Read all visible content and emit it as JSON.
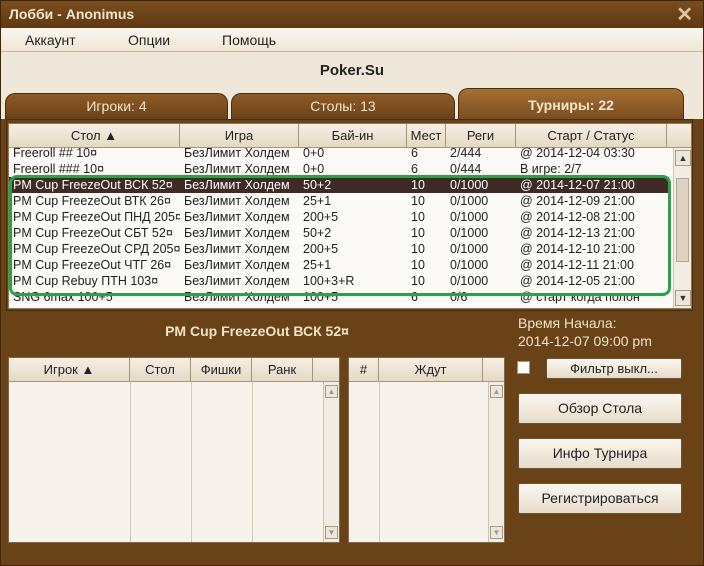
{
  "window": {
    "title": "Лобби - Anonimus"
  },
  "menu": {
    "items": [
      "Аккаунт",
      "Опции",
      "Помощь"
    ]
  },
  "brand": "Poker.Su",
  "tabs": [
    {
      "label": "Игроки: 4",
      "active": false
    },
    {
      "label": "Столы: 13",
      "active": false
    },
    {
      "label": "Турниры: 22",
      "active": true
    }
  ],
  "tournaments": {
    "columns": [
      "Стол ▲",
      "Игра",
      "Бай-ин",
      "Мест",
      "Реги",
      "Старт / Статус"
    ],
    "rows": [
      [
        "Freeroll ## 10¤",
        "БезЛимит Холдем",
        "0+0",
        "6",
        "2/444",
        "@ 2014-12-04 03:30"
      ],
      [
        "Freeroll ### 10¤",
        "БезЛимит Холдем",
        "0+0",
        "6",
        "0/444",
        "В игре: 2/7"
      ],
      [
        "PM Cup FreezeOut ВСК 52¤",
        "БезЛимит Холдем",
        "50+2",
        "10",
        "0/1000",
        "@ 2014-12-07 21:00"
      ],
      [
        "PM Cup FreezeOut ВТК 26¤",
        "БезЛимит Холдем",
        "25+1",
        "10",
        "0/1000",
        "@ 2014-12-09 21:00"
      ],
      [
        "PM Cup FreezeOut ПНД 205¤",
        "БезЛимит Холдем",
        "200+5",
        "10",
        "0/1000",
        "@ 2014-12-08 21:00"
      ],
      [
        "PM Cup FreezeOut СБТ 52¤",
        "БезЛимит Холдем",
        "50+2",
        "10",
        "0/1000",
        "@ 2014-12-13 21:00"
      ],
      [
        "PM Cup FreezeOut СРД 205¤",
        "БезЛимит Холдем",
        "200+5",
        "10",
        "0/1000",
        "@ 2014-12-10 21:00"
      ],
      [
        "PM Cup FreezeOut ЧТГ 26¤",
        "БезЛимит Холдем",
        "25+1",
        "10",
        "0/1000",
        "@ 2014-12-11 21:00"
      ],
      [
        "PM Cup Rebuy ПТН 103¤",
        "БезЛимит Холдем",
        "100+3+R",
        "10",
        "0/1000",
        "@ 2014-12-05 21:00"
      ],
      [
        "SNG 6max 100+5",
        "БезЛимит Холдем",
        "100+5",
        "6",
        "0/6",
        "@ старт когда полон"
      ]
    ],
    "selected_index": 2
  },
  "selected": {
    "title": "PM Cup FreezeOut ВСК 52¤",
    "start_label": "Время Начала:",
    "start_value": "2014-12-07 09:00 pm"
  },
  "players_table": {
    "columns": [
      "Игрок ▲",
      "Стол",
      "Фишки",
      "Ранк"
    ]
  },
  "waiting_table": {
    "columns": [
      "#",
      "Ждут"
    ]
  },
  "buttons": {
    "filter": "Фильтр выкл...",
    "table_view": "Обзор Стола",
    "tournament_info": "Инфо Турнира",
    "register": "Регистрироваться"
  },
  "colors": {
    "frame": "#6a4218",
    "selection": "#3e2c24",
    "highlight": "#2ca14a"
  }
}
